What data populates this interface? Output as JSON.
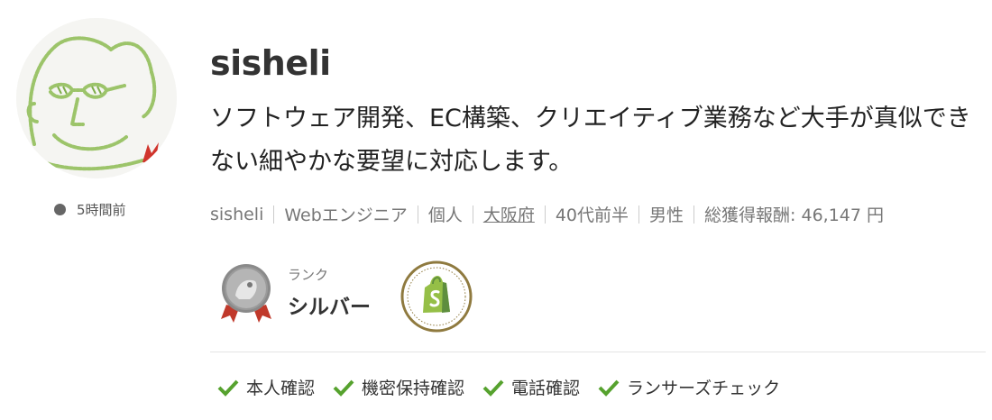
{
  "profile": {
    "username": "sisheli",
    "bio": "ソフトウェア開発、EC構築、クリエイティブ業務など大手が真似できない細やかな要望に対応します。",
    "last_seen": "5時間前",
    "avatar_icon": "caricature-face-avatar"
  },
  "meta": {
    "name": "sisheli",
    "occupation": "Webエンジニア",
    "type": "個人",
    "location": "大阪府",
    "age": "40代前半",
    "gender": "男性",
    "earnings": "総獲得報酬: 46,147 円"
  },
  "rank": {
    "label": "ランク",
    "value": "シルバー",
    "icon": "silver-medal-icon"
  },
  "badges": [
    {
      "icon": "shopify-icon"
    }
  ],
  "verifications": [
    {
      "label": "本人確認",
      "icon": "check-icon"
    },
    {
      "label": "機密保持確認",
      "icon": "check-icon"
    },
    {
      "label": "電話確認",
      "icon": "check-icon"
    },
    {
      "label": "ランサーズチェック",
      "icon": "check-icon"
    }
  ],
  "colors": {
    "check": "#56a22e",
    "shopify": "#95bf47",
    "badge_ring": "#8f7a3f",
    "medal_ribbon": "#c0392b"
  }
}
